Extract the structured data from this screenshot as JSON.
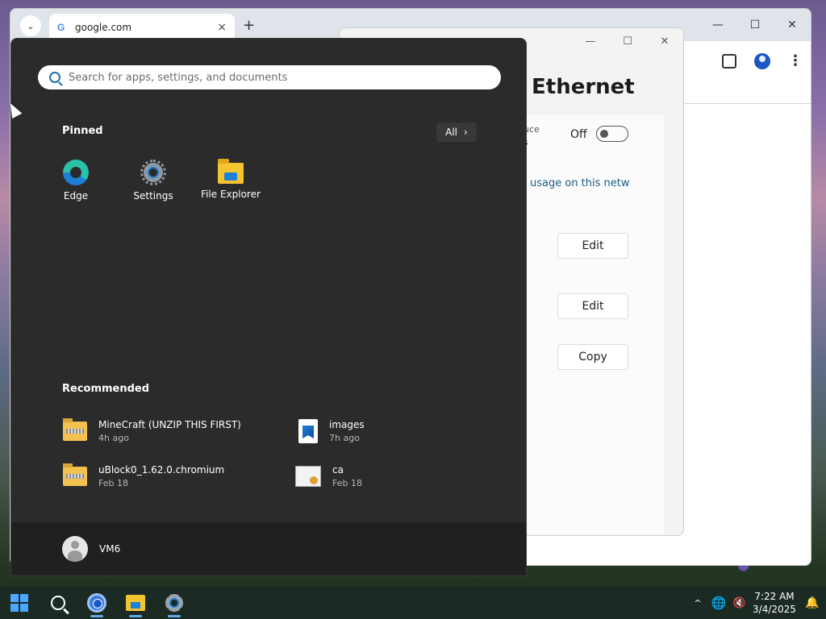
{
  "chrome": {
    "tab_title": "google.com",
    "tab_close": "×",
    "new_tab": "+",
    "tab_list": "⌄",
    "win_minimize": "—",
    "win_maximize": "☐",
    "win_close": "✕",
    "menu": "⋮"
  },
  "settings": {
    "title": "Ethernet",
    "cut_label_line1": "uce",
    "cut_label_line2": "s",
    "toggle_state": "Off",
    "link_text": "usage on this netwo",
    "edit_button_1": "Edit",
    "edit_button_2": "Edit",
    "copy_button": "Copy",
    "win_minimize": "—",
    "win_maximize": "☐",
    "win_close": "✕"
  },
  "start_menu": {
    "search": {
      "placeholder": "Search for apps, settings, and documents",
      "value": ""
    },
    "pinned_heading": "Pinned",
    "all_button": "All",
    "all_chevron": "›",
    "pinned": [
      {
        "label": "Edge",
        "icon": "edge-icon"
      },
      {
        "label": "Settings",
        "icon": "gear-icon"
      },
      {
        "label": "File Explorer",
        "icon": "folder-icon"
      }
    ],
    "recommended_heading": "Recommended",
    "recommended": [
      {
        "name": "MineCraft (UNZIP THIS FIRST)",
        "time": "4h ago",
        "icon": "zip-folder-icon"
      },
      {
        "name": "images",
        "time": "7h ago",
        "icon": "image-file-icon"
      },
      {
        "name": "uBlock0_1.62.0.chromium",
        "time": "Feb 18",
        "icon": "zip-folder-icon"
      },
      {
        "name": "ca",
        "time": "Feb 18",
        "icon": "certificate-icon"
      }
    ],
    "user_name": "VM6"
  },
  "taskbar": {
    "tray_chevron": "^",
    "globe": "🌐",
    "volume": "🔇",
    "time": "7:22 AM",
    "date": "3/4/2025",
    "bell": "🔔"
  },
  "colors": {
    "start_bg": "#2b2b2b",
    "accent": "#1e7fd8",
    "taskbar_bg": "#1c2a24"
  }
}
